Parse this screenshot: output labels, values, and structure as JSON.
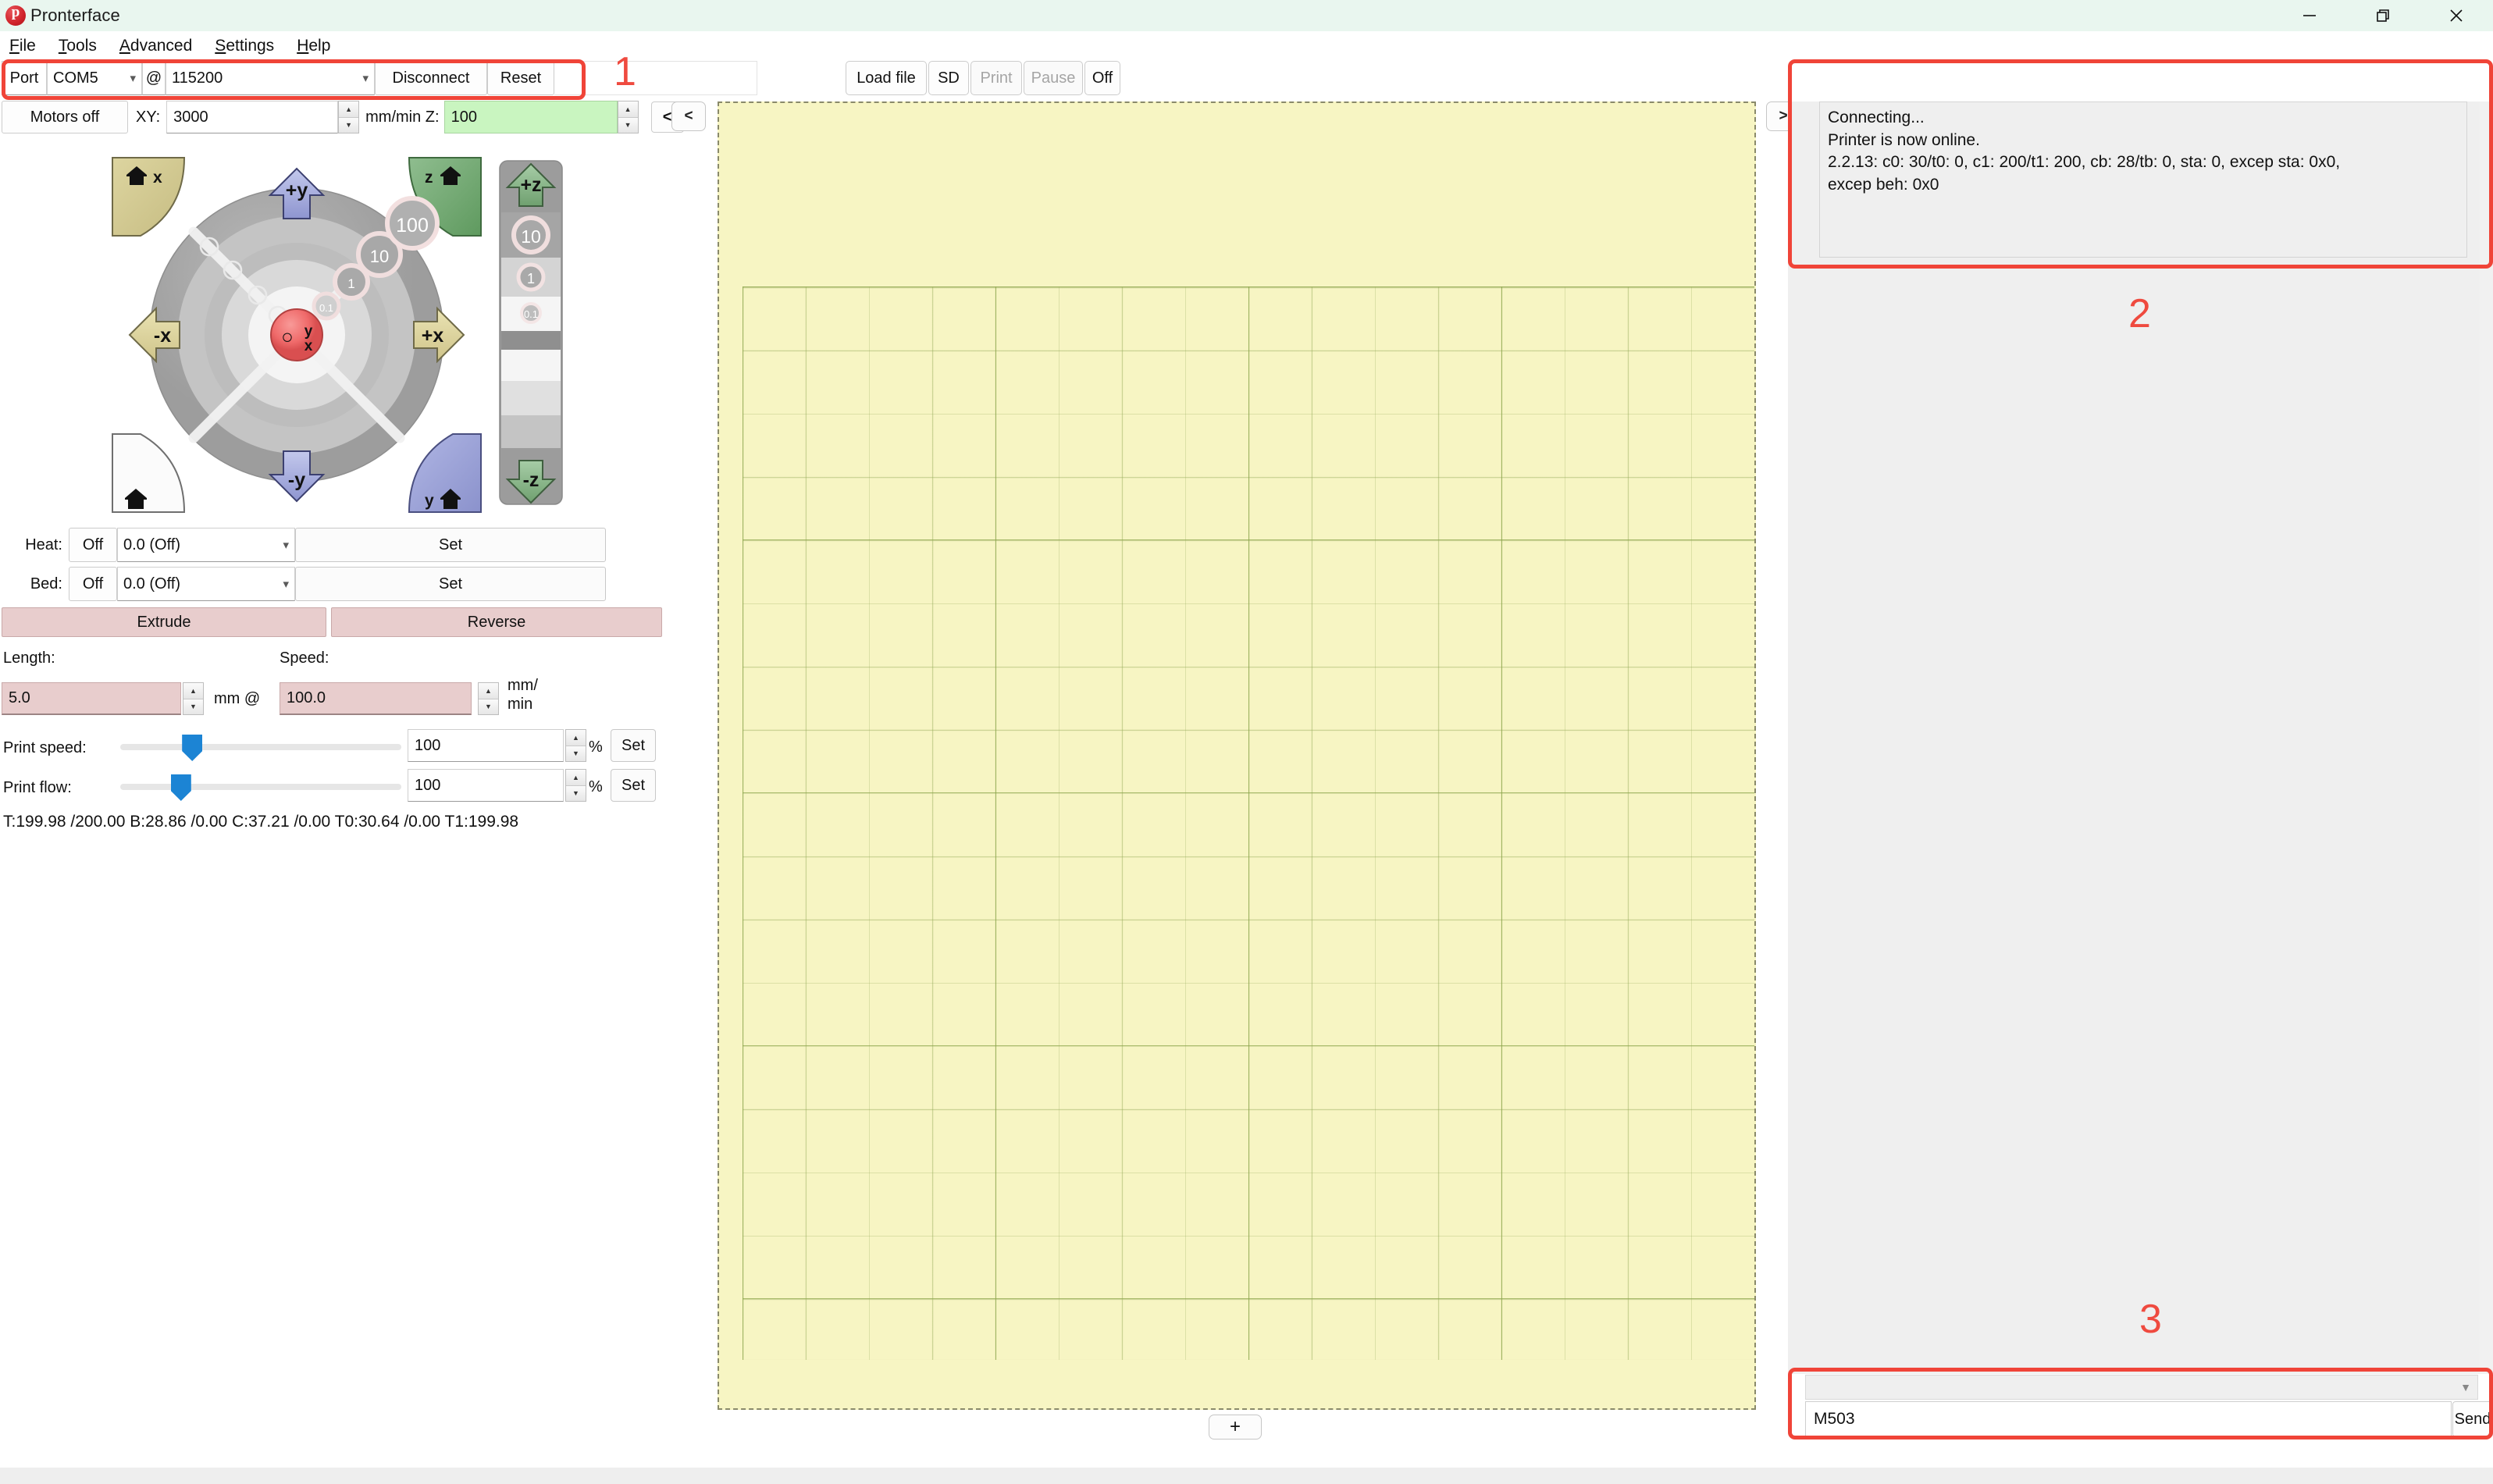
{
  "window": {
    "title": "Pronterface",
    "app_icon": "pronterface-logo-icon",
    "minimize": "minimize-icon",
    "maximize": "restore-icon",
    "close": "close-icon"
  },
  "menubar": {
    "items": [
      {
        "label": "File",
        "accel": "F"
      },
      {
        "label": "Tools",
        "accel": "T"
      },
      {
        "label": "Advanced",
        "accel": "A"
      },
      {
        "label": "Settings",
        "accel": "S"
      },
      {
        "label": "Help",
        "accel": "H"
      }
    ]
  },
  "connection": {
    "port_label": "Port",
    "port_value": "COM5",
    "at_label": "@",
    "baud_value": "115200",
    "disconnect_label": "Disconnect",
    "reset_label": "Reset"
  },
  "motion": {
    "motors_off_label": "Motors off",
    "xy_label": "XY:",
    "xy_value": "3000",
    "units_label": "mm/min Z:",
    "z_value": "100",
    "collapse_left_label": "<"
  },
  "jog": {
    "home_x": "home-x",
    "home_z": "home-z",
    "home_all": "home-all",
    "home_y": "home-y",
    "plus_y": "+y",
    "minus_y": "-y",
    "plus_x": "+x",
    "minus_x": "-x",
    "center_label": "0",
    "center_axes": "y x",
    "xy_steps": [
      "0.1",
      "1",
      "10",
      "100"
    ],
    "z_plus": "+z",
    "z_minus": "-z",
    "z_steps": [
      "10",
      "1",
      "0.1"
    ]
  },
  "temperature": {
    "heat_label": "Heat:",
    "heat_state": "Off",
    "heat_preset": "0.0 (Off)",
    "heat_set": "Set",
    "bed_label": "Bed:",
    "bed_state": "Off",
    "bed_preset": "0.0 (Off)",
    "bed_set": "Set"
  },
  "extruder": {
    "extrude_label": "Extrude",
    "reverse_label": "Reverse",
    "length_label": "Length:",
    "length_value": "5.0",
    "mm_at_label": "mm @",
    "speed_label": "Speed:",
    "speed_value": "100.0",
    "speed_units": "mm/\nmin",
    "speed_units_1": "mm/",
    "speed_units_2": "min"
  },
  "tuning": {
    "print_speed_label": "Print speed:",
    "print_speed_value": "100",
    "print_speed_pct": "%",
    "print_speed_set": "Set",
    "print_flow_label": "Print flow:",
    "print_flow_value": "100",
    "print_flow_pct": "%",
    "print_flow_set": "Set",
    "print_speed_slider_pct": 22,
    "print_flow_slider_pct": 18
  },
  "status": {
    "temps_line": "T:199.98 /200.00 B:28.86 /0.00 C:37.21 /0.00 T0:30.64 /0.00 T1:199.98"
  },
  "print_toolbar": {
    "load_file": "Load file",
    "sd": "SD",
    "print": "Print",
    "pause": "Pause",
    "off": "Off"
  },
  "viewer": {
    "collapse_right_label": ">",
    "add_label": "+"
  },
  "log": {
    "lines": [
      "Connecting...",
      "Printer is now online.",
      "2.2.13: c0: 30/t0: 0, c1: 200/t1: 200, cb: 28/tb: 0, sta: 0, excep sta: 0x0,",
      "excep beh: 0x0"
    ],
    "full_text": "Connecting...\nPrinter is now online.\n2.2.13: c0: 30/t0: 0, c1: 200/t1: 200, cb: 28/tb: 0, sta: 0, excep sta: 0x0,\nexcep beh: 0x0"
  },
  "command": {
    "history_placeholder": "",
    "value": "M503",
    "send_label": "Send"
  },
  "annotations": [
    {
      "number": "1",
      "target": "connection-bar"
    },
    {
      "number": "2",
      "target": "log-panel"
    },
    {
      "number": "3",
      "target": "command-bar"
    }
  ],
  "colors": {
    "annotation": "#ef4a3f",
    "titlebar_bg": "#e9f6ef",
    "plate_bg": "#f7f5c3",
    "z_field_bg": "#c9f5c0",
    "extrude_pink": "#e8cdcd",
    "slider_blue": "#1c84d4",
    "jog_center_red": "#ef6a6a",
    "home_x_olive": "#cfc48a",
    "home_z_green": "#7fae7f",
    "home_y_blue": "#9aa0d8",
    "axis_y_blue": "#a5acdf",
    "axis_x_olive": "#ddd6a0"
  }
}
